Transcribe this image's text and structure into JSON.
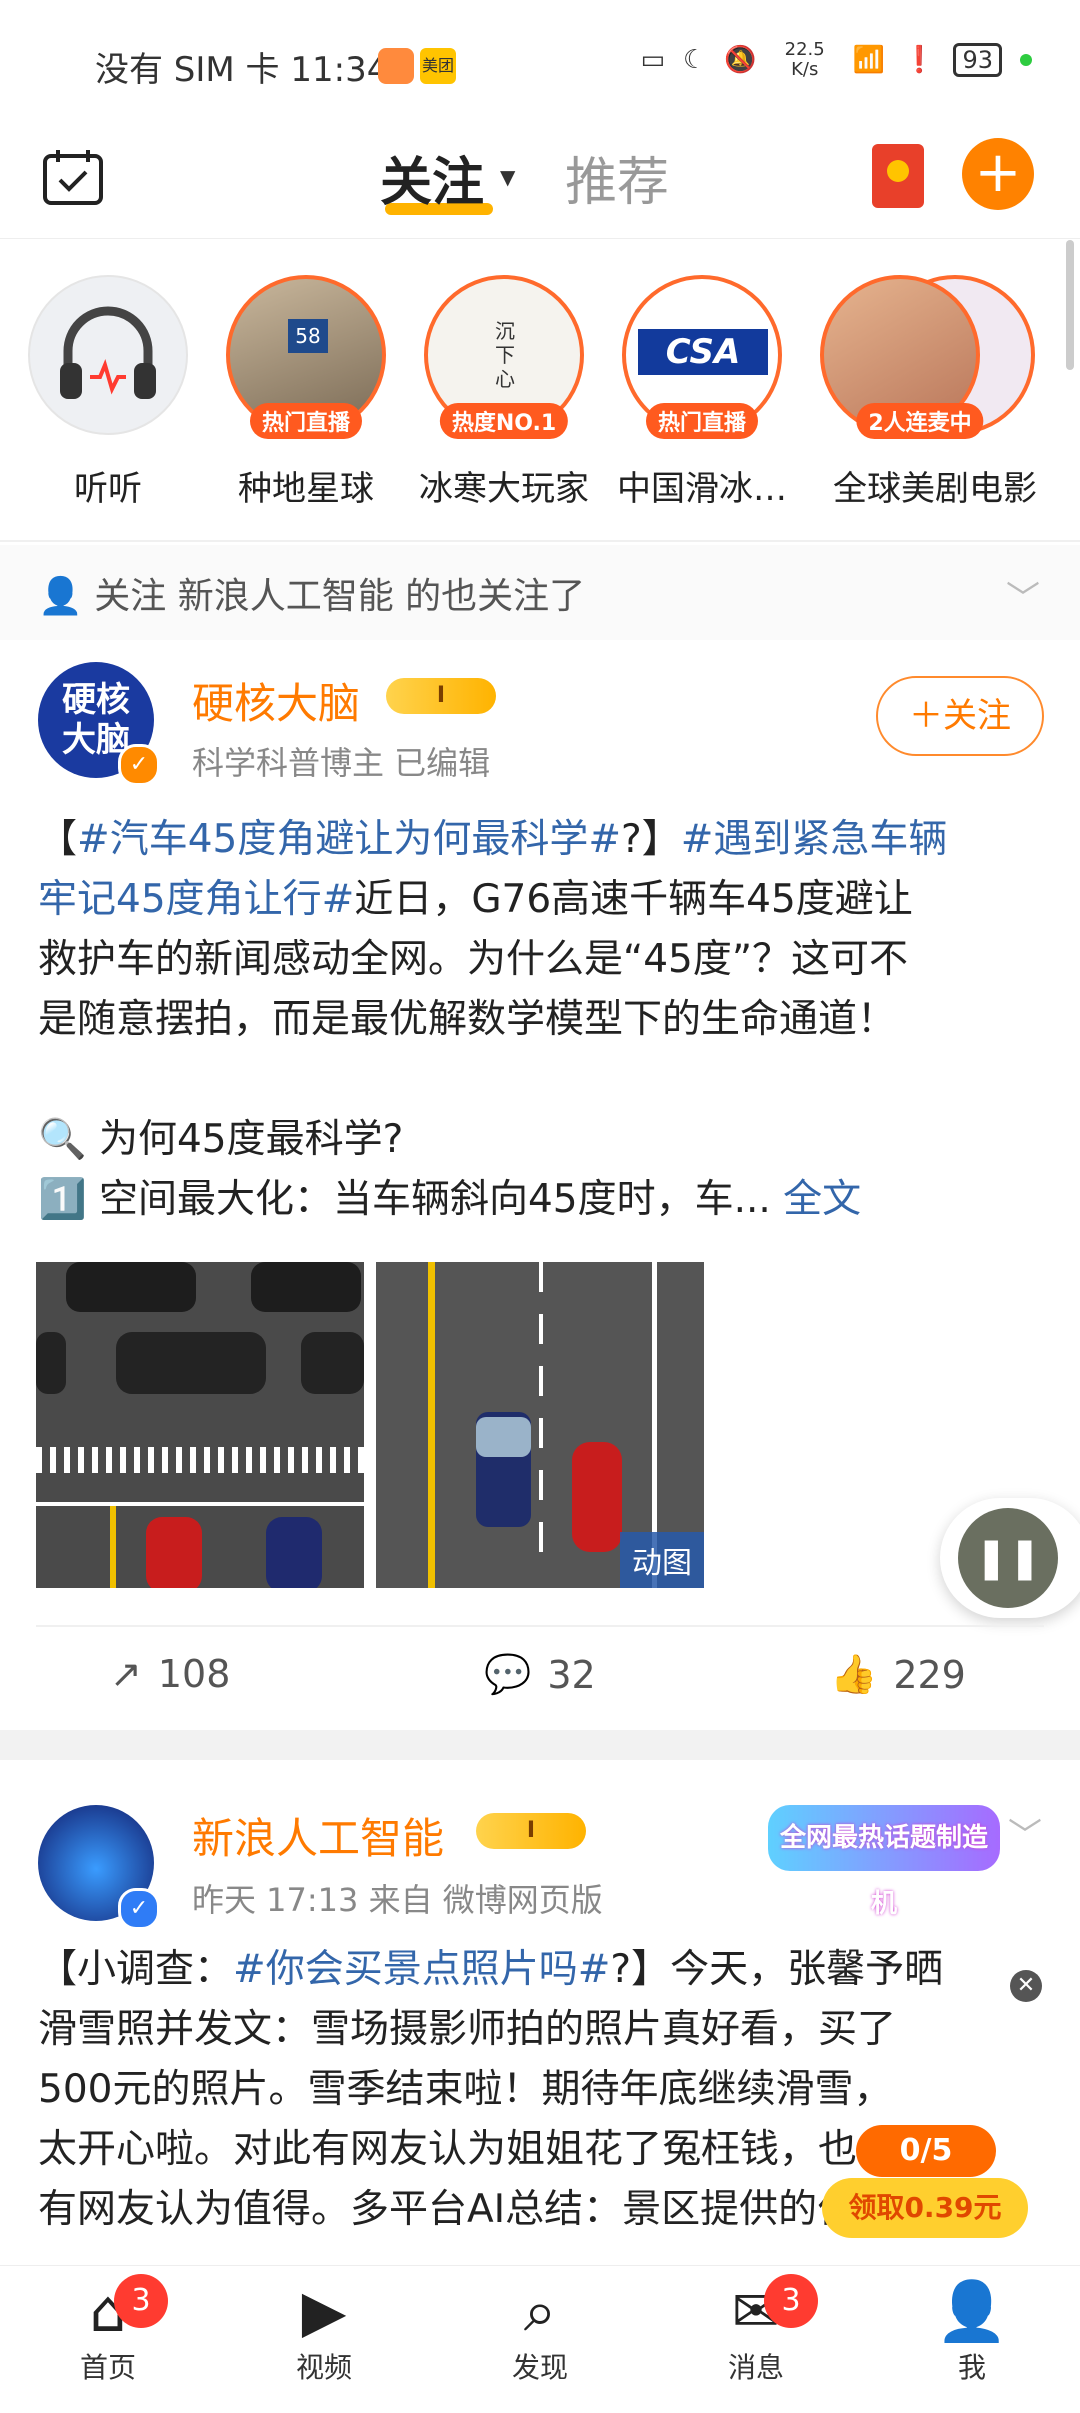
{
  "status_bar": {
    "left_text": "没有 SIM 卡 11:34",
    "badge2": "美团",
    "net_speed": "22.5 K/s",
    "battery": "93"
  },
  "header": {
    "tab_follow": "关注",
    "tab_recommend": "推荐"
  },
  "stories": [
    {
      "name": "听听",
      "tag": ""
    },
    {
      "name": "种地星球",
      "tag": "热门直播"
    },
    {
      "name": "冰寒大玩家",
      "tag": "热度NO.1"
    },
    {
      "name": "中国滑冰…",
      "tag": "热门直播"
    },
    {
      "name": "全球美剧电影",
      "tag": "2人连麦中"
    }
  ],
  "rec_strip": {
    "text": "关注 新浪人工智能 的也关注了"
  },
  "post1": {
    "username": "硬核大脑",
    "vip": "I",
    "meta": "科学科普博主   已编辑",
    "follow": "＋关注",
    "avatar_text": "硬核大脑",
    "body_lines": [
      [
        "【",
        "#汽车45度角避让为何最科学#",
        "?】",
        "#遇到紧急车辆"
      ],
      [
        "",
        "牢记45度角让行#",
        "近日，G76高速千辆车45度避让",
        ""
      ],
      [
        "救护车的新闻感动全网。为什么是“45度”？这可不",
        "",
        "",
        ""
      ],
      [
        "是随意摆拍，而是最优解数学模型下的生命通道！",
        "",
        "",
        ""
      ]
    ],
    "line5": "🔍 为何45度最科学?",
    "line6": "1️⃣ 空间最大化：当车辆斜向45度时，车... ",
    "fulltext": "全文",
    "gif_label": "动图",
    "reposts": "108",
    "comments": "32",
    "likes": "229"
  },
  "post2": {
    "username": "新浪人工智能",
    "vip": "I",
    "meta": "昨天 17:13   来自 微博网页版",
    "banner": "全网最热话题制造机",
    "line1_a": "【小调查：",
    "line1_b": "#你会买景点照片吗#",
    "line1_c": "?】今天，张馨予晒",
    "line2": "滑雪照并发文：雪场摄影师拍的照片真好看，买了",
    "line3": "500元的照片。雪季结束啦！期待年底继续滑雪，",
    "line4": "太开心啦。对此有网友认为姐姐花了冤枉钱，也",
    "line5": "有网友认为值得。多平台AI总结：景区提供的付费",
    "reward_count": "0/5",
    "reward_text": "领取0.39元"
  },
  "nav": [
    {
      "label": "首页",
      "badge": "3"
    },
    {
      "label": "视频",
      "badge": ""
    },
    {
      "label": "发现",
      "badge": ""
    },
    {
      "label": "消息",
      "badge": "3"
    },
    {
      "label": "我",
      "badge": ""
    }
  ]
}
